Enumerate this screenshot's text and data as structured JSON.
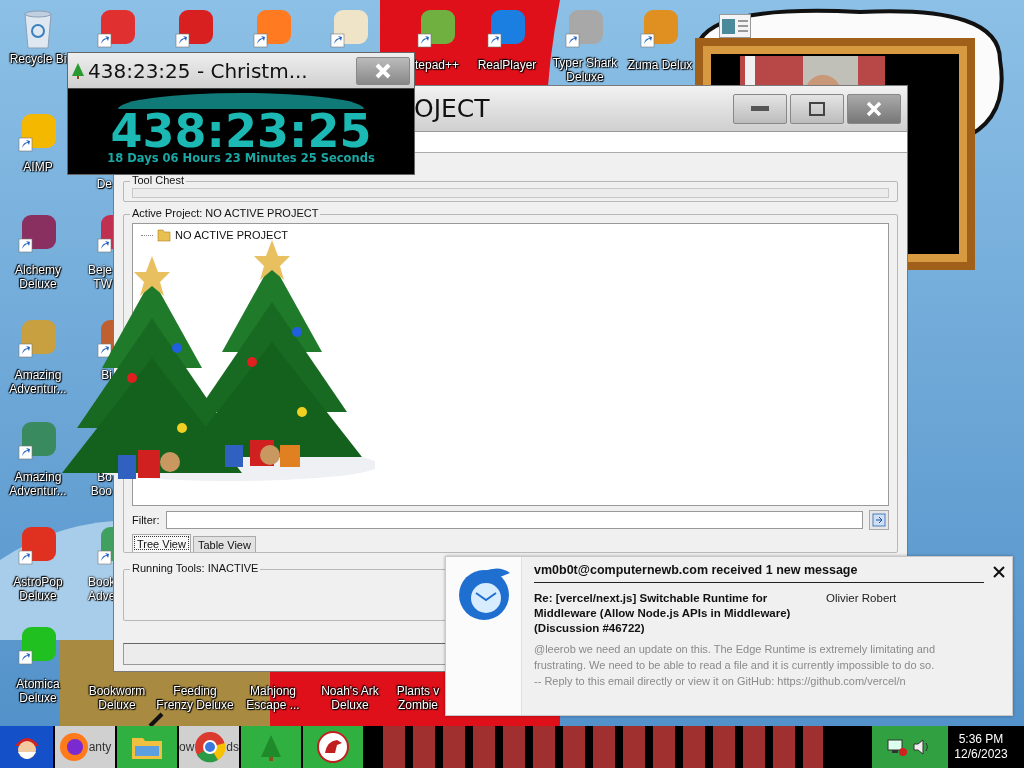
{
  "desktop": {
    "icons": [
      {
        "kind": "bin",
        "label": "Recycle Bi"
      },
      {
        "kind": "shortcut"
      },
      {
        "kind": "shortcut"
      },
      {
        "kind": "shortcut"
      },
      {
        "kind": "shortcut"
      },
      {
        "kind": "shortcut",
        "label": "tepad++"
      },
      {
        "kind": "shortcut",
        "label": "RealPlayer"
      },
      {
        "kind": "shortcut",
        "label": "Typer Shark Deluxe"
      },
      {
        "kind": "shortcut",
        "label": "Zuma Delux"
      },
      {
        "kind": "document"
      },
      {
        "kind": "shortcut",
        "label": "AIMP"
      },
      {
        "kind": "shortcut",
        "label": "Alchemy Deluxe"
      },
      {
        "kind": "shortcut",
        "label": "Amazing Adventur..."
      },
      {
        "kind": "shortcut",
        "label": "Amazing Adventur..."
      },
      {
        "kind": "shortcut",
        "label": "AstroPop Deluxe"
      },
      {
        "kind": "shortcut",
        "label": "Atomica Deluxe"
      },
      {
        "kind": "label_only",
        "label": "De"
      },
      {
        "kind": "shortcut",
        "label": "Beje TW"
      },
      {
        "kind": "shortcut",
        "label": "Bi"
      },
      {
        "kind": "label_only",
        "label": "Bo Boo"
      },
      {
        "kind": "shortcut",
        "label": "Book Adve"
      },
      {
        "kind": "label_only",
        "label": "Bookworm Deluxe"
      },
      {
        "kind": "label_only",
        "label": "Feeding Frenzy Deluxe"
      },
      {
        "kind": "label_only",
        "label": "Mahjong Escape ..."
      },
      {
        "kind": "label_only",
        "label": "Noah's Ark Deluxe"
      },
      {
        "kind": "label_only",
        "label": "Plants v Zombie"
      }
    ]
  },
  "timer_window": {
    "title": "438:23:25 - Christm...",
    "time": "438:23:25",
    "detail": "18 Days 06 Hours 23 Minutes 25 Seconds"
  },
  "main_window": {
    "title": "OJECT",
    "tool_chest": {
      "legend": "Tool Chest"
    },
    "active_project": {
      "legend": "Active Project: NO ACTIVE PROJECT",
      "tree": [
        {
          "kind": "folder",
          "label": "NO ACTIVE PROJECT"
        }
      ],
      "filter": {
        "label": "Filter:"
      },
      "tabs": [
        {
          "label": "Tree View",
          "selected": true
        },
        {
          "label": "Table View",
          "selected": false
        }
      ]
    },
    "running_tools": {
      "legend": "Running Tools: INACTIVE"
    }
  },
  "notification": {
    "title": "vm0b0t@computernewb.com received 1 new message",
    "subject": "Re: [vercel/next.js] Switchable Runtime for Middleware (Allow Node.js APIs in Middleware) (Discussion #46722)",
    "author": "Olivier Robert",
    "body": [
      "@leerob we need an update on this. The Edge Runtime is extremely limitating and frustrating. We need to be able to read a file and it is currently impossible to do so.",
      "-- Reply to this email directly or view it on GitHub: https://github.com/vercel/n"
    ]
  },
  "taskbar": {
    "items": [
      {
        "kind": "browser",
        "label": "anty"
      },
      {
        "kind": "folder"
      },
      {
        "kind": "chrome",
        "label_left": "ow",
        "label_right": "ds"
      },
      {
        "kind": "tree"
      },
      {
        "kind": "dino"
      }
    ],
    "clock": {
      "time": "5:36 PM",
      "date": "12/6/2023"
    }
  }
}
